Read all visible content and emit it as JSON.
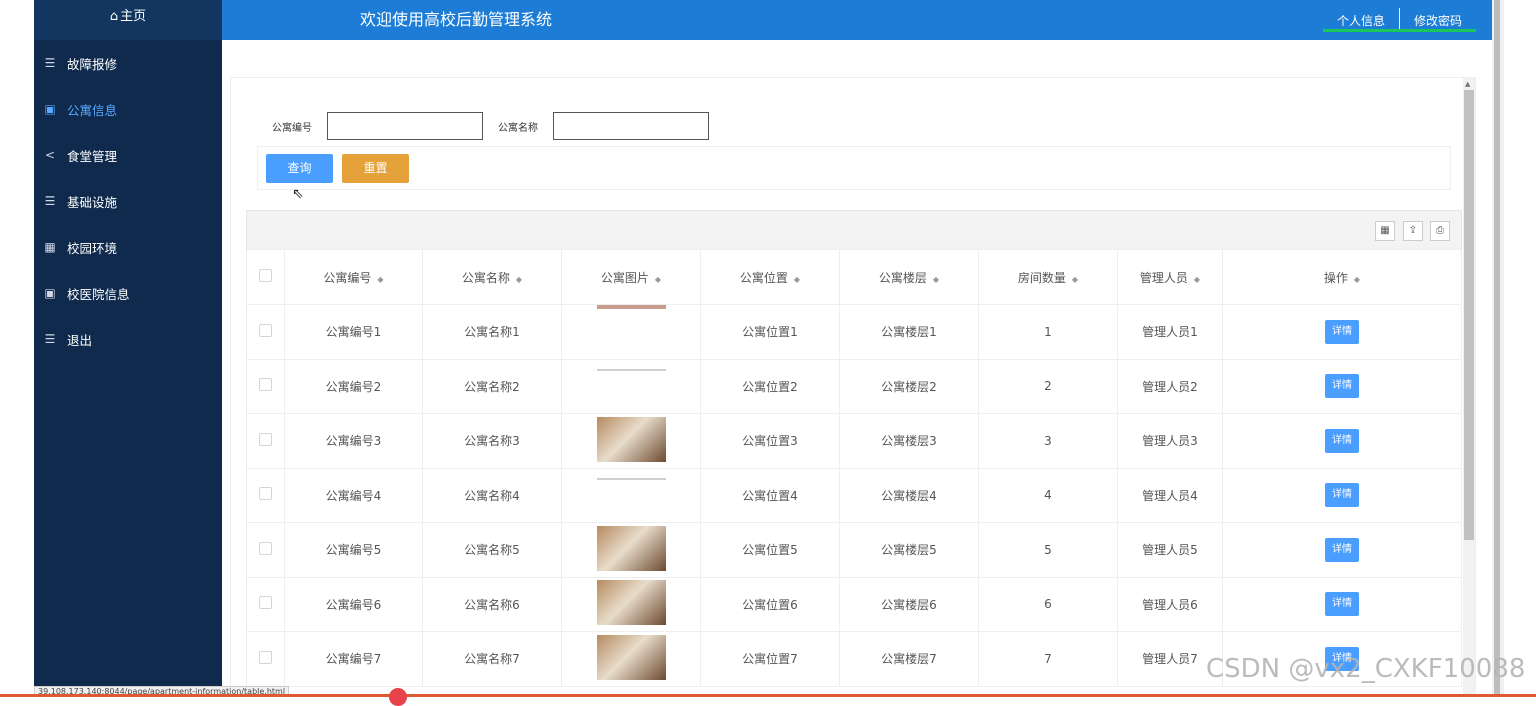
{
  "sidebar": {
    "home": "主页",
    "items": [
      {
        "label": "故障报修",
        "icon": "list-icon"
      },
      {
        "label": "公寓信息",
        "icon": "book-icon",
        "active": true
      },
      {
        "label": "食堂管理",
        "icon": "share-icon"
      },
      {
        "label": "基础设施",
        "icon": "list-icon"
      },
      {
        "label": "校园环境",
        "icon": "grid-icon"
      },
      {
        "label": "校医院信息",
        "icon": "book-icon"
      },
      {
        "label": "退出",
        "icon": "list-icon"
      }
    ]
  },
  "header": {
    "title": "欢迎使用高校后勤管理系统",
    "profile": "个人信息",
    "change_password": "修改密码"
  },
  "search": {
    "label_code": "公寓编号",
    "label_name": "公寓名称",
    "query_button": "查询",
    "reset_button": "重置"
  },
  "table": {
    "columns": [
      "公寓编号",
      "公寓名称",
      "公寓图片",
      "公寓位置",
      "公寓楼层",
      "房间数量",
      "管理人员",
      "操作"
    ],
    "detail_label": "详情",
    "rows": [
      {
        "code": "公寓编号1",
        "name": "公寓名称1",
        "image": "line-top",
        "location": "公寓位置1",
        "floor": "公寓楼层1",
        "rooms": "1",
        "manager": "管理人员1"
      },
      {
        "code": "公寓编号2",
        "name": "公寓名称2",
        "image": "line-top",
        "location": "公寓位置2",
        "floor": "公寓楼层2",
        "rooms": "2",
        "manager": "管理人员2"
      },
      {
        "code": "公寓编号3",
        "name": "公寓名称3",
        "image": "photo",
        "location": "公寓位置3",
        "floor": "公寓楼层3",
        "rooms": "3",
        "manager": "管理人员3"
      },
      {
        "code": "公寓编号4",
        "name": "公寓名称4",
        "image": "line-top",
        "location": "公寓位置4",
        "floor": "公寓楼层4",
        "rooms": "4",
        "manager": "管理人员4"
      },
      {
        "code": "公寓编号5",
        "name": "公寓名称5",
        "image": "photo",
        "location": "公寓位置5",
        "floor": "公寓楼层5",
        "rooms": "5",
        "manager": "管理人员5"
      },
      {
        "code": "公寓编号6",
        "name": "公寓名称6",
        "image": "photo",
        "location": "公寓位置6",
        "floor": "公寓楼层6",
        "rooms": "6",
        "manager": "管理人员6"
      },
      {
        "code": "公寓编号7",
        "name": "公寓名称7",
        "image": "photo",
        "location": "公寓位置7",
        "floor": "公寓楼层7",
        "rooms": "7",
        "manager": "管理人员7"
      }
    ]
  },
  "status_url": "39.108.173.140:8044/page/apartment-information/table.html",
  "watermark": "CSDN @vx2_CXKF10088",
  "colors": {
    "sidebar": "#0f2a4d",
    "topbar": "#1d7dd6",
    "primary": "#4a9eff",
    "reset": "#e5a13a"
  }
}
